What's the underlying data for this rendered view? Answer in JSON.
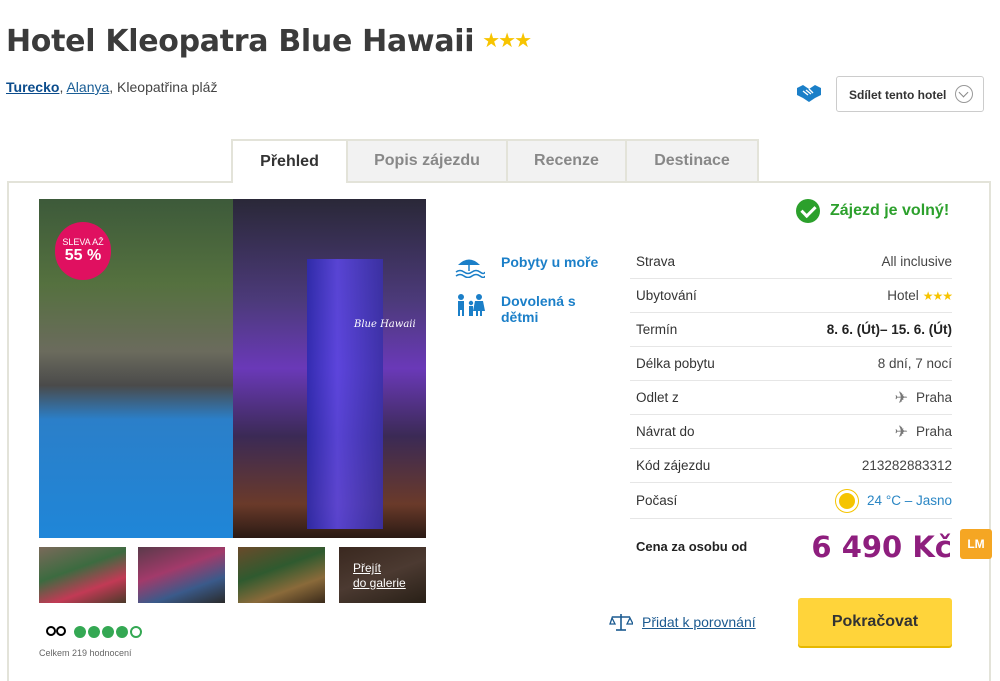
{
  "hotel": {
    "name": "Hotel Kleopatra Blue Hawaii",
    "stars": "★★★"
  },
  "breadcrumb": {
    "country": "Turecko",
    "region": "Alanya",
    "area": "Kleopatřina pláž",
    "sep": ","
  },
  "share": {
    "label": "Sdílet tento hotel",
    "icon": "handshake-icon"
  },
  "tabs": [
    {
      "label": "Přehled",
      "active": true
    },
    {
      "label": "Popis zájezdu"
    },
    {
      "label": "Recenze"
    },
    {
      "label": "Destinace"
    }
  ],
  "gallery": {
    "sale_line1": "SLEVA AŽ",
    "sale_line2": "55 %",
    "hotel_sign": "Blue Hawaii",
    "more_line1": "Přejít",
    "more_line2": "do galerie"
  },
  "rating": {
    "review_count": "Celkem 219 hodnocení",
    "dots_full": 4,
    "dots_total": 5
  },
  "features": [
    {
      "icon": "beach-umbrella-icon",
      "label": "Pobyty u moře"
    },
    {
      "icon": "family-icon",
      "label": "Dovolená s dětmi"
    }
  ],
  "availability": "Zájezd je volný!",
  "details": {
    "strava": {
      "label": "Strava",
      "value": "All inclusive"
    },
    "ubytovani": {
      "label": "Ubytování",
      "value": "Hotel",
      "stars": "★★★"
    },
    "termin": {
      "label": "Termín",
      "value": "8. 6. (Út)– 15. 6. (Út)"
    },
    "delka": {
      "label": "Délka pobytu",
      "value": "8 dní, 7 nocí"
    },
    "odlet": {
      "label": "Odlet z",
      "value": "Praha"
    },
    "navrat": {
      "label": "Návrat do",
      "value": "Praha"
    },
    "kod": {
      "label": "Kód zájezdu",
      "value": "213282883312"
    },
    "pocasi": {
      "label": "Počasí",
      "value": "24 °C – Jasno"
    }
  },
  "price": {
    "label": "Cena za osobu od",
    "value": "6 490 Kč",
    "badge": "LM"
  },
  "compare": {
    "label": "Přidat k porovnání"
  },
  "continue": {
    "label": "Pokračovat"
  },
  "colors": {
    "accent": "#8e1e7e",
    "button": "#ffd43a",
    "link": "#1b7fc8",
    "success": "#2ca02c",
    "sale": "#e01060"
  }
}
